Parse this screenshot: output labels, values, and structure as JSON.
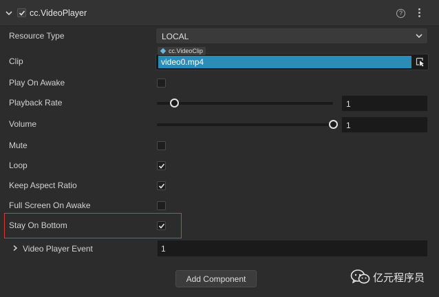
{
  "component": {
    "title": "cc.VideoPlayer",
    "enabled": true,
    "help_glyph": "?",
    "icons": [
      "chevron-down-icon",
      "help-icon",
      "more-vertical-icon"
    ]
  },
  "properties": {
    "resource_type": {
      "label": "Resource Type",
      "value": "LOCAL"
    },
    "clip": {
      "label": "Clip",
      "asset_type": "cc.VideoClip",
      "value": "video0.mp4"
    },
    "play_on_awake": {
      "label": "Play On Awake",
      "checked": false
    },
    "playback_rate": {
      "label": "Playback Rate",
      "value": "1",
      "slider_fraction": 0.1
    },
    "volume": {
      "label": "Volume",
      "value": "1",
      "slider_fraction": 1.0
    },
    "mute": {
      "label": "Mute",
      "checked": false
    },
    "loop": {
      "label": "Loop",
      "checked": true
    },
    "keep_aspect_ratio": {
      "label": "Keep Aspect Ratio",
      "checked": true
    },
    "full_screen_on_awake": {
      "label": "Full Screen On Awake",
      "checked": false
    },
    "stay_on_bottom": {
      "label": "Stay On Bottom",
      "checked": true
    },
    "video_player_event": {
      "label": "Video Player Event",
      "value": "1"
    }
  },
  "add_component_label": "Add Component",
  "watermark": {
    "text": "亿元程序员"
  },
  "colors": {
    "accent": "#2b8db5",
    "highlight_border": "#d93b3b",
    "panel_bg": "#2c2c2c"
  }
}
